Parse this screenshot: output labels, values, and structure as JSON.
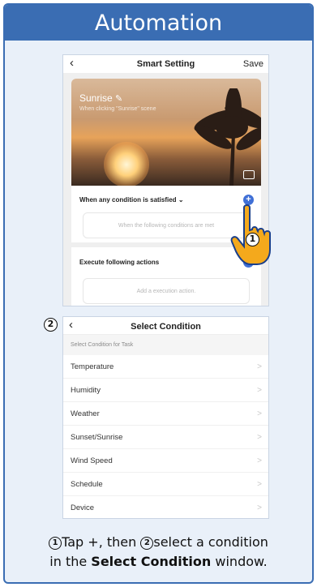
{
  "header": {
    "title": "Automation"
  },
  "screen1": {
    "back_icon": "chevron-left-icon",
    "title": "Smart Setting",
    "save_label": "Save",
    "scene_name": "Sunrise",
    "scene_subtitle": "When clicking \"Sunrise\" scene",
    "condition_title": "When any condition is satisfied",
    "condition_placeholder": "When the following conditions are met",
    "action_title": "Execute following actions",
    "action_placeholder": "Add a execution action.",
    "accent_color": "#3f6fd6"
  },
  "screen2": {
    "back_icon": "chevron-left-icon",
    "title": "Select Condition",
    "subtitle": "Select Condition for Task",
    "conditions": [
      "Temperature",
      "Humidity",
      "Weather",
      "Sunset/Sunrise",
      "Wind Speed",
      "Schedule",
      "Device"
    ]
  },
  "badges": {
    "step1": "1",
    "step2": "2"
  },
  "caption": {
    "step1_num": "1",
    "step1_text": "Tap +, then",
    "step2_num": "2",
    "step2_text": "select a condition",
    "line2_prefix": "in the",
    "line2_bold": "Select Condition",
    "line2_suffix": "window."
  },
  "colors": {
    "frame": "#3a6db3",
    "background": "#e9f0f9"
  }
}
